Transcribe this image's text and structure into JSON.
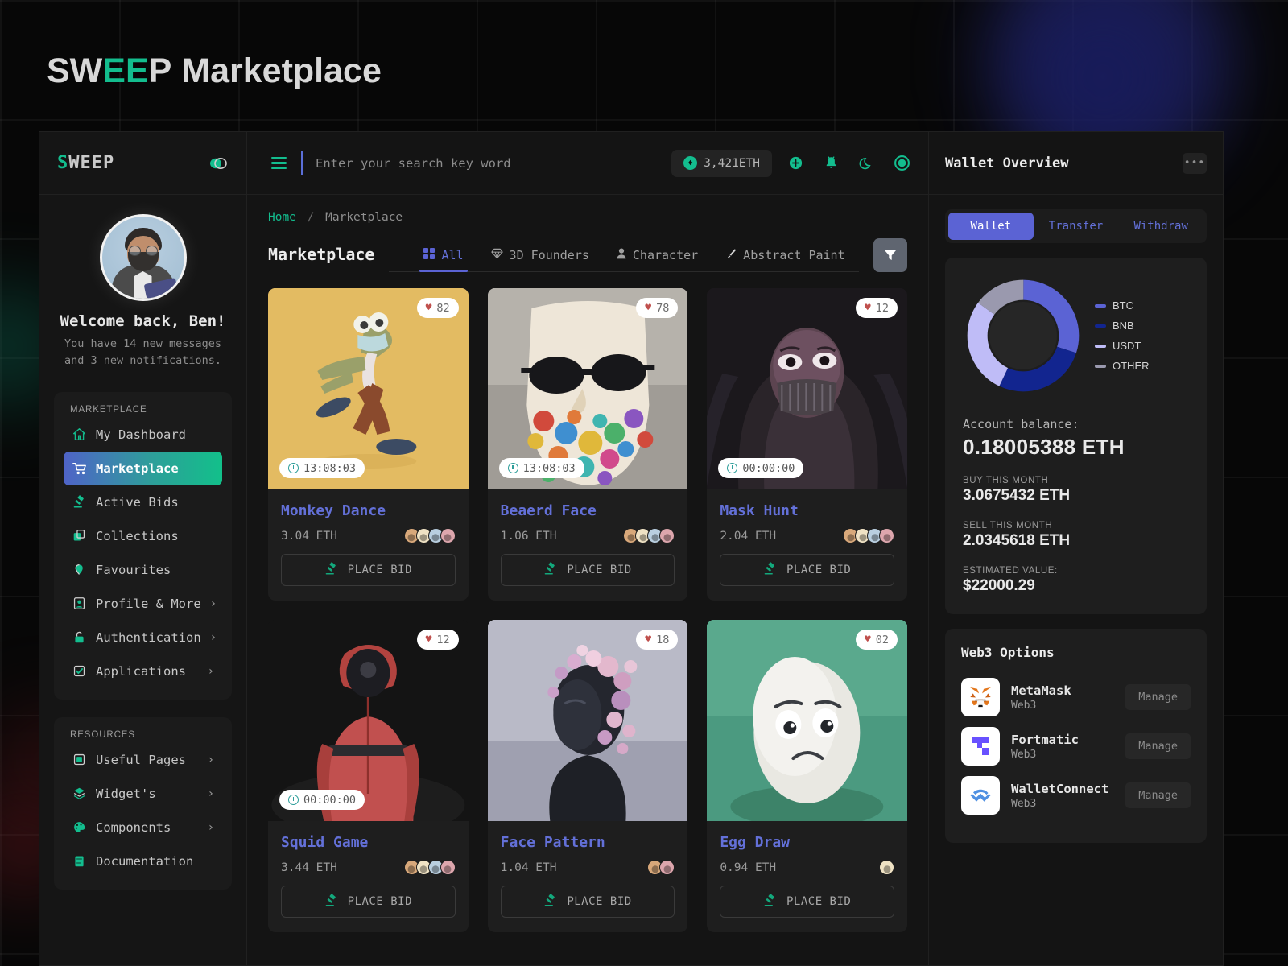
{
  "page": {
    "title_part1": "SW",
    "title_accent": "EE",
    "title_part2": "P",
    "title_rest": " Marketplace"
  },
  "sidebar": {
    "brand_s": "S",
    "brand_rest": "WEEP",
    "toggle_icon": "link-toggle-icon",
    "welcome": "Welcome back, Ben!",
    "welcome_sub": "You have 14 new messages and 3 new notifications.",
    "group1_label": "MARKETPLACE",
    "group1_items": [
      {
        "label": "My Dashboard",
        "icon": "home-icon",
        "chevron": "",
        "active": false
      },
      {
        "label": "Marketplace",
        "icon": "cart-icon",
        "chevron": "",
        "active": true
      },
      {
        "label": "Active Bids",
        "icon": "gavel-icon",
        "chevron": "",
        "active": false
      },
      {
        "label": "Collections",
        "icon": "collections-icon",
        "chevron": "",
        "active": false
      },
      {
        "label": "Favourites",
        "icon": "heart-shield-icon",
        "chevron": "",
        "active": false
      },
      {
        "label": "Profile & More",
        "icon": "profile-card-icon",
        "chevron": "›",
        "active": false
      },
      {
        "label": "Authentication",
        "icon": "lock-icon",
        "chevron": "›",
        "active": false
      },
      {
        "label": "Applications",
        "icon": "apps-icon",
        "chevron": "›",
        "active": false
      }
    ],
    "group2_label": "RESOURCES",
    "group2_items": [
      {
        "label": "Useful Pages",
        "icon": "square-icon",
        "chevron": "›"
      },
      {
        "label": "Widget's",
        "icon": "layers-icon",
        "chevron": "›"
      },
      {
        "label": "Components",
        "icon": "palette-icon",
        "chevron": "›"
      },
      {
        "label": "Documentation",
        "icon": "notebook-icon",
        "chevron": ""
      }
    ]
  },
  "topbar": {
    "menu_icon": "hamburger-icon",
    "search_placeholder": "Enter your search key word",
    "search_value": "",
    "eth_balance": "3,421ETH",
    "eth_icon": "eth-coin-icon",
    "icons": [
      "add-circle-icon",
      "notification-bell-icon",
      "dark-mode-moon-icon",
      "profile-ring-icon"
    ]
  },
  "breadcrumb": {
    "home": "Home",
    "separator": "/",
    "current": "Marketplace"
  },
  "main": {
    "section_title": "Marketplace",
    "tabs": [
      {
        "label": "All",
        "icon": "grid-icon",
        "active": true
      },
      {
        "label": "3D Founders",
        "icon": "diamond-icon",
        "active": false
      },
      {
        "label": "Character",
        "icon": "person-icon",
        "active": false
      },
      {
        "label": "Abstract Paint",
        "icon": "brush-icon",
        "active": false
      }
    ],
    "filter_icon": "filter-funnel-icon",
    "bid_label": "PLACE BID",
    "bid_icon": "gavel-icon",
    "cards": [
      {
        "name": "Monkey Dance",
        "price": "3.04 ETH",
        "likes": "82",
        "timer": "13:08:03",
        "avatars": 4,
        "theme": "monkey"
      },
      {
        "name": "Beaerd Face",
        "price": "1.06 ETH",
        "likes": "78",
        "timer": "13:08:03",
        "avatars": 4,
        "theme": "beard"
      },
      {
        "name": "Mask Hunt",
        "price": "2.04 ETH",
        "likes": "12",
        "timer": "00:00:00",
        "avatars": 4,
        "theme": "mask"
      },
      {
        "name": "Squid Game",
        "price": "3.44 ETH",
        "likes": "12",
        "timer": "00:00:00",
        "avatars": 4,
        "theme": "squid"
      },
      {
        "name": "Face Pattern",
        "price": "1.04 ETH",
        "likes": "18",
        "timer": "",
        "avatars": 2,
        "theme": "face"
      },
      {
        "name": "Egg Draw",
        "price": "0.94 ETH",
        "likes": "02",
        "timer": "",
        "avatars": 1,
        "theme": "egg"
      }
    ]
  },
  "wallet": {
    "title": "Wallet Overview",
    "more_icon": "more-dots-icon",
    "tabs": [
      {
        "label": "Wallet",
        "active": true
      },
      {
        "label": "Transfer",
        "active": false
      },
      {
        "label": "Withdraw",
        "active": false
      }
    ],
    "balance_label": "Account balance:",
    "balance_value": "0.18005388 ETH",
    "stats": [
      {
        "label": "BUY THIS MONTH",
        "value": "3.0675432 ETH"
      },
      {
        "label": "SELL THIS MONTH",
        "value": "2.0345618 ETH"
      },
      {
        "label": "ESTIMATED VALUE:",
        "value": "$22000.29"
      }
    ]
  },
  "chart_data": {
    "type": "pie",
    "title": "Wallet Overview",
    "categories": [
      "BTC",
      "BNB",
      "USDT",
      "OTHER"
    ],
    "values": [
      30,
      27,
      28,
      15
    ],
    "colors": [
      "#5b63d4",
      "#12258f",
      "#bfbcf7",
      "#9a99ae"
    ],
    "legend_position": "right",
    "donut": true
  },
  "web3": {
    "title": "Web3 Options",
    "items": [
      {
        "name": "MetaMask",
        "sub": "Web3",
        "action": "Manage",
        "logo": "metamask-fox-icon"
      },
      {
        "name": "Fortmatic",
        "sub": "Web3",
        "action": "Manage",
        "logo": "fortmatic-icon"
      },
      {
        "name": "WalletConnect",
        "sub": "Web3",
        "action": "Manage",
        "logo": "walletconnect-icon"
      }
    ]
  }
}
